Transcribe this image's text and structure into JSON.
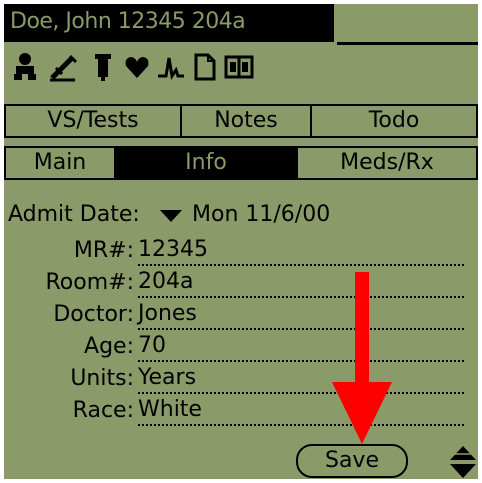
{
  "title": "Doe, John 12345 204a",
  "icons": [
    "person-icon",
    "injection-icon",
    "test-tube-icon",
    "heart-icon",
    "pulse-wave-icon",
    "document-icon",
    "book-icon"
  ],
  "tabs_row1": [
    "VS/Tests",
    "Notes",
    "Todo"
  ],
  "tabs_row2": [
    "Main",
    "Info",
    "Meds/Rx"
  ],
  "active_tab": "Info",
  "admit": {
    "label": "Admit Date:",
    "value": "Mon 11/6/00"
  },
  "fields": [
    {
      "label": "MR#:",
      "value": "12345"
    },
    {
      "label": "Room#:",
      "value": "204a"
    },
    {
      "label": "Doctor:",
      "value": "Jones"
    },
    {
      "label": "Age:",
      "value": "70"
    },
    {
      "label": "Units:",
      "value": "Years"
    },
    {
      "label": "Race:",
      "value": "White"
    }
  ],
  "save_label": "Save",
  "colors": {
    "screen": "#8a9a68",
    "ink": "#000000",
    "annotation": "#ff0000"
  }
}
